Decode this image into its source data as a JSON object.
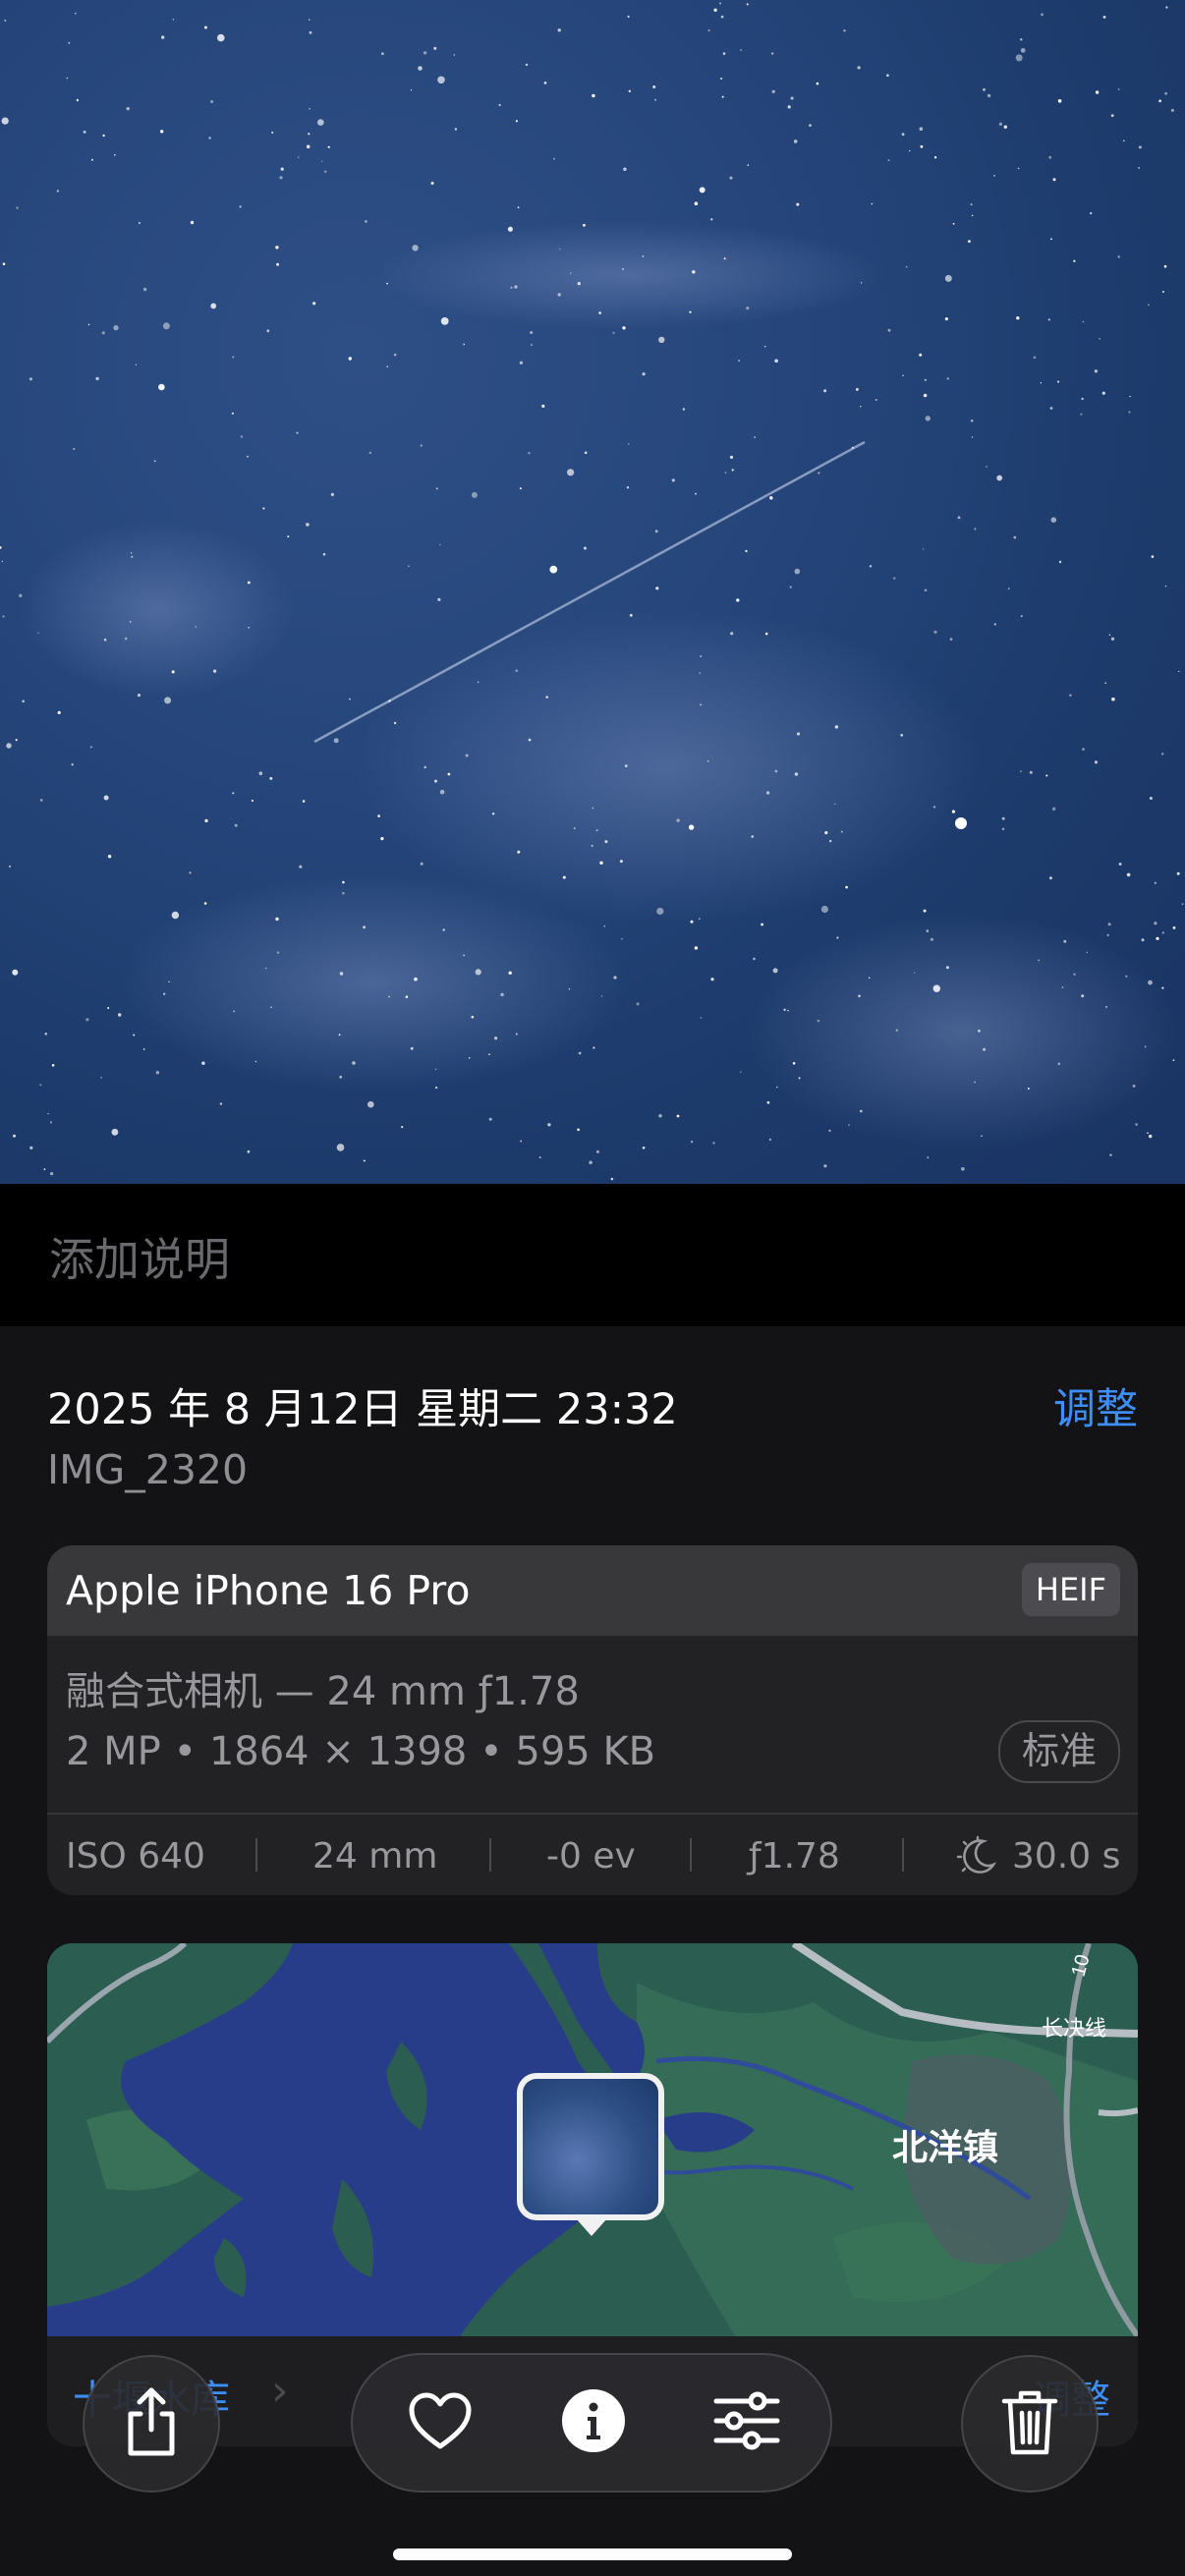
{
  "caption": {
    "placeholder": "添加说明"
  },
  "header": {
    "date": "2025 年 8 月12日 星期二 23:32",
    "adjust_label": "调整",
    "filename": "IMG_2320"
  },
  "camera": {
    "name": "Apple iPhone 16 Pro",
    "format": "HEIF",
    "lens": "融合式相机 — 24 mm ƒ1.78",
    "resolution": "2 MP • 1864 × 1398 • 595 KB",
    "quality": "标准",
    "exif": {
      "iso": "ISO 640",
      "focal": "24 mm",
      "ev": "-0 ev",
      "aperture": "ƒ1.78",
      "shutter": "30.0 s"
    }
  },
  "map": {
    "town_label": "北洋镇",
    "road_label": "长决线",
    "road_number": "10",
    "place_label": "十堰水库",
    "edit_label": "调整"
  },
  "toolbar": {
    "share_icon": "share-icon",
    "favorite_icon": "heart-icon",
    "info_icon": "info-icon",
    "adjust_icon": "sliders-icon",
    "delete_icon": "trash-icon"
  },
  "colors": {
    "accent": "#3d8ef7",
    "panel": "#131315",
    "card": "#222224"
  }
}
